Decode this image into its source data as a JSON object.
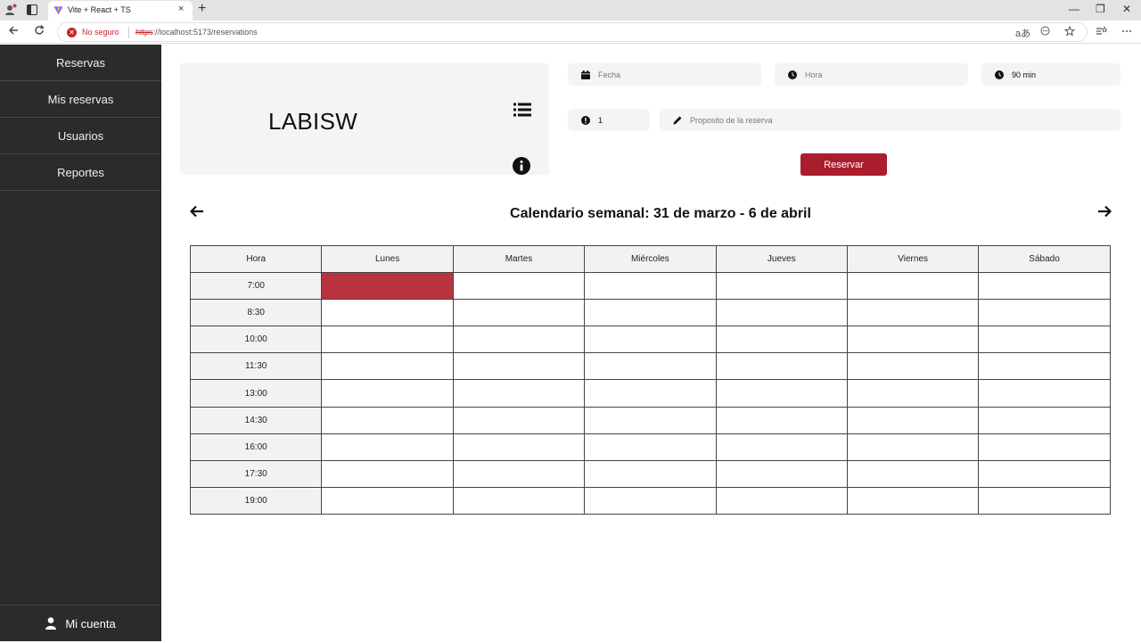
{
  "browser": {
    "tab_title": "Vite + React + TS",
    "tab_close": "×",
    "new_tab": "+",
    "security_label": "No seguro",
    "url_scheme": "https",
    "url_rest": "://localhost:5173/reservations",
    "window_controls": {
      "minimize": "—",
      "restore": "❐",
      "close": "✕"
    },
    "reader_label": "aあ"
  },
  "sidebar": {
    "items": [
      {
        "label": "Reservas"
      },
      {
        "label": "Mis reservas"
      },
      {
        "label": "Usuarios"
      },
      {
        "label": "Reportes"
      }
    ],
    "account_label": "Mi cuenta"
  },
  "lab": {
    "name": "LABISW"
  },
  "form": {
    "date_placeholder": "Fecha",
    "time_placeholder": "Hora",
    "duration_value": "90 min",
    "count_value": "1",
    "purpose_placeholder": "Proposito de la reserva",
    "reserve_label": "Reservar"
  },
  "calendar": {
    "title": "Calendario semanal: 31 de marzo - 6 de abril",
    "hour_header": "Hora",
    "days": [
      "Lunes",
      "Martes",
      "Miércoles",
      "Jueves",
      "Viernes",
      "Sábado"
    ],
    "hours": [
      "7:00",
      "8:30",
      "10:00",
      "11:30",
      "13:00",
      "14:30",
      "16:00",
      "17:30",
      "19:00"
    ],
    "booked": [
      {
        "hour": "7:00",
        "day": "Lunes"
      }
    ]
  },
  "colors": {
    "sidebar_bg": "#2b2b2b",
    "accent": "#ab1c2d",
    "booked_slot": "#b8323f"
  }
}
